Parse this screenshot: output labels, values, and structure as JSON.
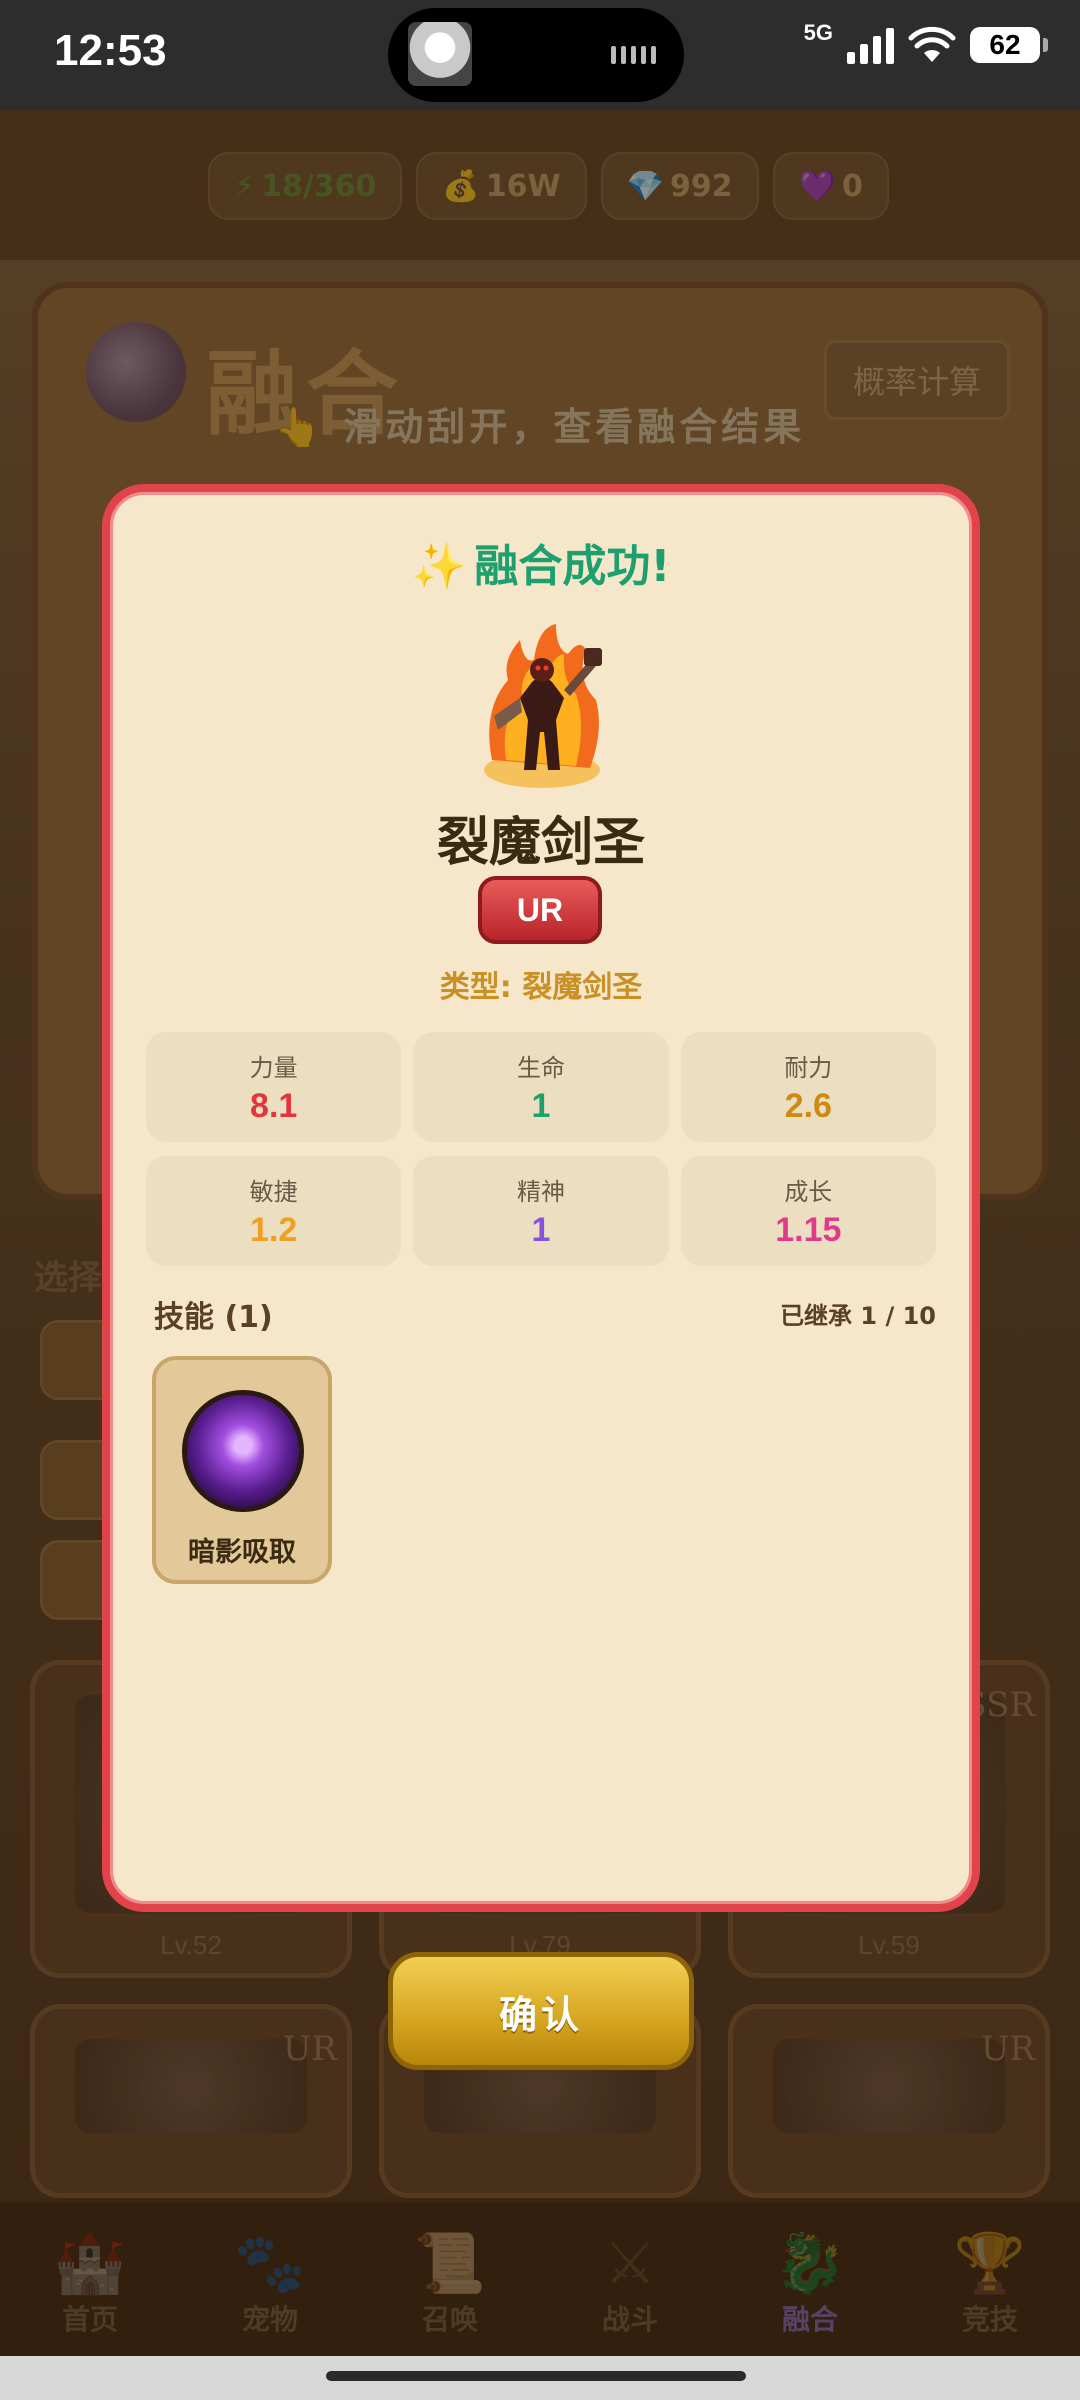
{
  "status_bar": {
    "time": "12:53",
    "network": "5G",
    "battery": "62"
  },
  "resources": {
    "energy": "18/360",
    "gold": "16W",
    "diamonds": "992",
    "hearts": "0"
  },
  "background": {
    "panel_title": "融合",
    "prob_button": "概率计算",
    "scratch_hint": "滑动刮开，查看融合结果",
    "select_label": "选择",
    "cards": [
      {
        "level": "Lv.52",
        "rarity": ""
      },
      {
        "level": "Lv.79",
        "rarity": ""
      },
      {
        "level": "Lv.59",
        "rarity": "SSR"
      },
      {
        "level": "",
        "rarity": "UR"
      },
      {
        "level": "",
        "rarity": ""
      },
      {
        "level": "",
        "rarity": "UR"
      }
    ]
  },
  "modal": {
    "title": "融合成功!",
    "title_icon": "sparkles-icon",
    "hero_name": "裂魔剑圣",
    "rarity": "UR",
    "type_text": "类型: 裂魔剑圣",
    "stats": [
      {
        "label": "力量",
        "value": "8.1",
        "color": "#e0363c"
      },
      {
        "label": "生命",
        "value": "1",
        "color": "#1ea06a"
      },
      {
        "label": "耐力",
        "value": "2.6",
        "color": "#d08a14"
      },
      {
        "label": "敏捷",
        "value": "1.2",
        "color": "#f0a020"
      },
      {
        "label": "精神",
        "value": "1",
        "color": "#8a50e0"
      },
      {
        "label": "成长",
        "value": "1.15",
        "color": "#e03a8a"
      }
    ],
    "skills_header": "技能 (1)",
    "inherit_count": "已继承 1 / 10",
    "skills": [
      {
        "name": "暗影吸取",
        "icon": "shadow-drain-icon"
      }
    ]
  },
  "confirm_label": "确认",
  "nav": [
    {
      "label": "首页",
      "icon": "castle-icon"
    },
    {
      "label": "宠物",
      "icon": "paw-icon"
    },
    {
      "label": "召唤",
      "icon": "scroll-icon"
    },
    {
      "label": "战斗",
      "icon": "crossed-swords-icon"
    },
    {
      "label": "融合",
      "icon": "dragon-icon",
      "active": true
    },
    {
      "label": "竞技",
      "icon": "trophy-icon"
    }
  ]
}
